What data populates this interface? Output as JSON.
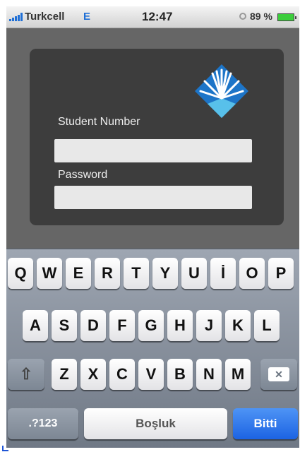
{
  "status_bar": {
    "carrier": "Turkcell",
    "network": "E",
    "time": "12:47",
    "battery_percent": "89 %",
    "signal_icon": "signal-bars-icon",
    "battery_icon": "battery-icon",
    "lock_icon": "rotation-lock-icon"
  },
  "login": {
    "logo_icon": "university-logo-icon",
    "student_number_label": "Student Number",
    "student_number_value": "",
    "password_label": "Password",
    "password_value": ""
  },
  "keyboard": {
    "row1": [
      "Q",
      "W",
      "E",
      "R",
      "T",
      "Y",
      "U",
      "İ",
      "O",
      "P"
    ],
    "row2": [
      "A",
      "S",
      "D",
      "F",
      "G",
      "H",
      "J",
      "K",
      "L"
    ],
    "row3": [
      "Z",
      "X",
      "C",
      "V",
      "B",
      "N",
      "M"
    ],
    "shift_icon": "shift-icon",
    "backspace_icon": "backspace-icon",
    "numbers_label": ".?123",
    "space_label": "Boşluk",
    "done_label": "Bitti"
  },
  "colors": {
    "background": "#666666",
    "panel": "#3d3d3d",
    "accent_blue": "#1f6fd6",
    "logo_blue": "#1d75c8"
  }
}
